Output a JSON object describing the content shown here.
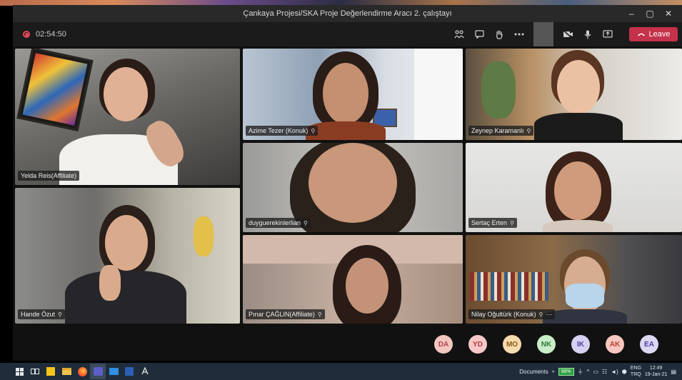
{
  "window": {
    "title": "Çankaya Projesi/SKA Proje Değerlendirme Aracı 2. çalıştayı",
    "min": "–",
    "max": "▢",
    "close": "✕"
  },
  "toolbar": {
    "timer": "02:54:50",
    "leave_label": "Leave"
  },
  "participants": [
    {
      "name": "Yelda Reis(Affiliate)"
    },
    {
      "name": "Azime Tezer (Konuk)"
    },
    {
      "name": "Zeynep Karamanlı"
    },
    {
      "name": "duyguerekinlerlian"
    },
    {
      "name": "Sertaç Erten"
    },
    {
      "name": "Hande Özut"
    },
    {
      "name": "Pınar ÇAĞLIN(Affiliate)"
    },
    {
      "name": "Nilay Oğultürk (Konuk)"
    }
  ],
  "avatars": [
    {
      "initials": "DA",
      "bg": "#f3c6c0",
      "fg": "#b0434e"
    },
    {
      "initials": "YD",
      "bg": "#f8c8c8",
      "fg": "#b53a3a"
    },
    {
      "initials": "MO",
      "bg": "#f5dcae",
      "fg": "#8a5a12"
    },
    {
      "initials": "NK",
      "bg": "#c9ecc9",
      "fg": "#2e7d32"
    },
    {
      "initials": "IK",
      "bg": "#d6d1f1",
      "fg": "#4a3f96"
    },
    {
      "initials": "AK",
      "bg": "#f8c7c0",
      "fg": "#b3402f"
    },
    {
      "initials": "EA",
      "bg": "#dcd7f3",
      "fg": "#4b3ea0"
    }
  ],
  "taskbar": {
    "documents_label": "Documents",
    "battery": "98%",
    "lang_top": "ENG",
    "lang_bottom": "TRQ",
    "time": "12:49",
    "date": "19-Jan-21"
  }
}
